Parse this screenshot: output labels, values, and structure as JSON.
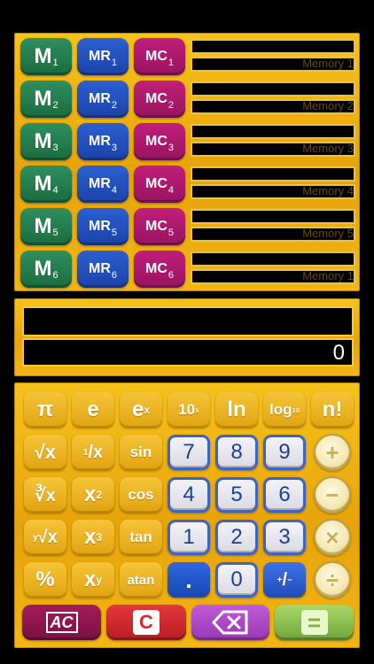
{
  "memory": {
    "rows": [
      {
        "m": "M",
        "mr": "MR",
        "mc": "MC",
        "index": "1",
        "label": "Memory 1"
      },
      {
        "m": "M",
        "mr": "MR",
        "mc": "MC",
        "index": "2",
        "label": "Memory 2"
      },
      {
        "m": "M",
        "mr": "MR",
        "mc": "MC",
        "index": "3",
        "label": "Memory 3"
      },
      {
        "m": "M",
        "mr": "MR",
        "mc": "MC",
        "index": "4",
        "label": "Memory 4"
      },
      {
        "m": "M",
        "mr": "MR",
        "mc": "MC",
        "index": "5",
        "label": "Memory 5"
      },
      {
        "m": "M",
        "mr": "MR",
        "mc": "MC",
        "index": "6",
        "label": "Memory 1"
      }
    ]
  },
  "display": {
    "expression": "",
    "result": "0"
  },
  "keypad": {
    "row1": {
      "pi": "π",
      "e": "e",
      "ex_base": "e",
      "ex_sup": "x",
      "tenx_base": "10",
      "tenx_sup": "x",
      "ln": "ln",
      "log_base": "log",
      "log_sub": "10",
      "fact": "n!"
    },
    "row2": {
      "sqrt": "√x",
      "recip_num": "1",
      "recip_den": "x",
      "sin": "sin",
      "seven": "7",
      "eight": "8",
      "nine": "9",
      "plus": "+"
    },
    "row3": {
      "cbrt": "∛x",
      "sq_base": "x",
      "sq_sup": "2",
      "cos": "cos",
      "four": "4",
      "five": "5",
      "six": "6",
      "minus": "−"
    },
    "row4": {
      "yroot_idx": "y",
      "yroot": "√x",
      "cube_base": "x",
      "cube_sup": "3",
      "tan": "tan",
      "one": "1",
      "two": "2",
      "three": "3",
      "times": "×"
    },
    "row5": {
      "percent": "%",
      "pow_base": "x",
      "pow_sup": "y",
      "atan": "atan",
      "dot": ".",
      "zero": "0",
      "sign_plus": "+",
      "sign_minus": "−",
      "divide": "÷"
    },
    "bottom": {
      "ac": "AC",
      "c": "C",
      "back": "⌫",
      "equals": "="
    }
  },
  "colors": {
    "panel": "#f0b518",
    "memory_green": "#1a6b3f",
    "memory_blue": "#1b43a8",
    "memory_magenta": "#98145f",
    "ac": "#7b1042",
    "clear": "#b81d22",
    "backspace": "#9a38b4",
    "equals": "#6fa638"
  }
}
